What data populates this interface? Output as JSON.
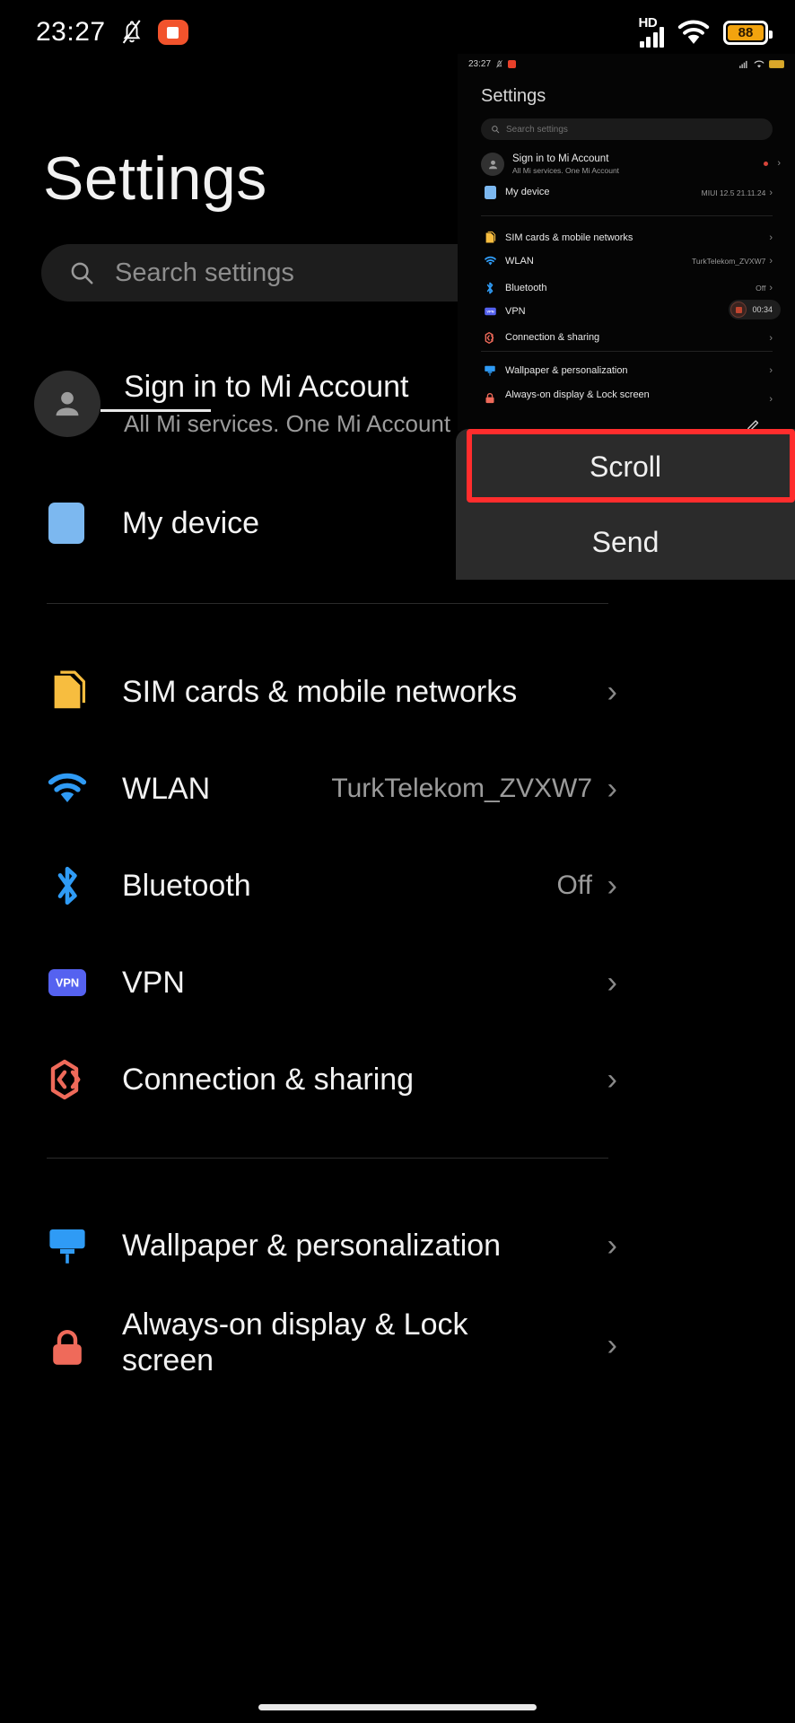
{
  "status_bar": {
    "time": "23:27",
    "mute_icon": "bell-slash-icon",
    "recording_icon": "screen-record-icon",
    "hd_label": "HD",
    "signal_icon": "signal-bars-icon",
    "wifi_icon": "wifi-icon",
    "battery_percent": "88"
  },
  "main": {
    "title": "Settings",
    "search": {
      "placeholder": "Search settings",
      "icon": "search-icon"
    },
    "account": {
      "title": "Sign in to Mi Account",
      "subtitle": "All Mi services. One Mi Account",
      "avatar_icon": "person-icon"
    },
    "device": {
      "label": "My device",
      "value": "MIUI 12.",
      "icon": "device-icon"
    },
    "items": [
      {
        "label": "SIM cards & mobile networks",
        "value": "",
        "icon": "sim-card-icon"
      },
      {
        "label": "WLAN",
        "value": "TurkTelekom_ZVXW7",
        "icon": "wifi-icon"
      },
      {
        "label": "Bluetooth",
        "value": "Off",
        "icon": "bluetooth-icon"
      },
      {
        "label": "VPN",
        "value": "",
        "icon": "vpn-icon"
      },
      {
        "label": "Connection & sharing",
        "value": "",
        "icon": "connection-sharing-icon"
      }
    ],
    "items2": [
      {
        "label": "Wallpaper & personalization",
        "value": "",
        "icon": "wallpaper-icon"
      },
      {
        "label": "Always-on display & Lock screen",
        "value": "",
        "icon": "lock-icon"
      }
    ],
    "chevron": "›"
  },
  "preview": {
    "status": {
      "time": "23:27",
      "recording_icon": "screen-record-icon"
    },
    "title": "Settings",
    "search_placeholder": "Search settings",
    "account": {
      "title": "Sign in to Mi Account",
      "subtitle": "All Mi services. One Mi Account"
    },
    "device": {
      "label": "My device",
      "value": "MIUI 12.5 21.11.24"
    },
    "items": [
      {
        "label": "SIM cards & mobile networks",
        "value": ""
      },
      {
        "label": "WLAN",
        "value": "TurkTelekom_ZVXW7"
      },
      {
        "label": "Bluetooth",
        "value": "Off"
      },
      {
        "label": "VPN",
        "value": ""
      },
      {
        "label": "Connection & sharing",
        "value": ""
      },
      {
        "label": "Wallpaper & personalization",
        "value": ""
      },
      {
        "label": "Always-on display & Lock screen",
        "value": ""
      }
    ],
    "timer": "00:34",
    "chevron": "›",
    "edit_icon": "pencil-icon"
  },
  "actions": {
    "scroll_label": "Scroll",
    "send_label": "Send",
    "highlight_color": "#ff2d2d"
  },
  "colors": {
    "background": "#000000",
    "sim": "#f7bd3f",
    "wlan": "#2f9bf5",
    "bluetooth": "#2f9bf5",
    "vpn": "#5562f0",
    "connection": "#ef6a5a",
    "wallpaper": "#2f9bf5",
    "lock": "#ef6a5a",
    "device": "#7cb8f0",
    "battery": "#f2a30e"
  }
}
